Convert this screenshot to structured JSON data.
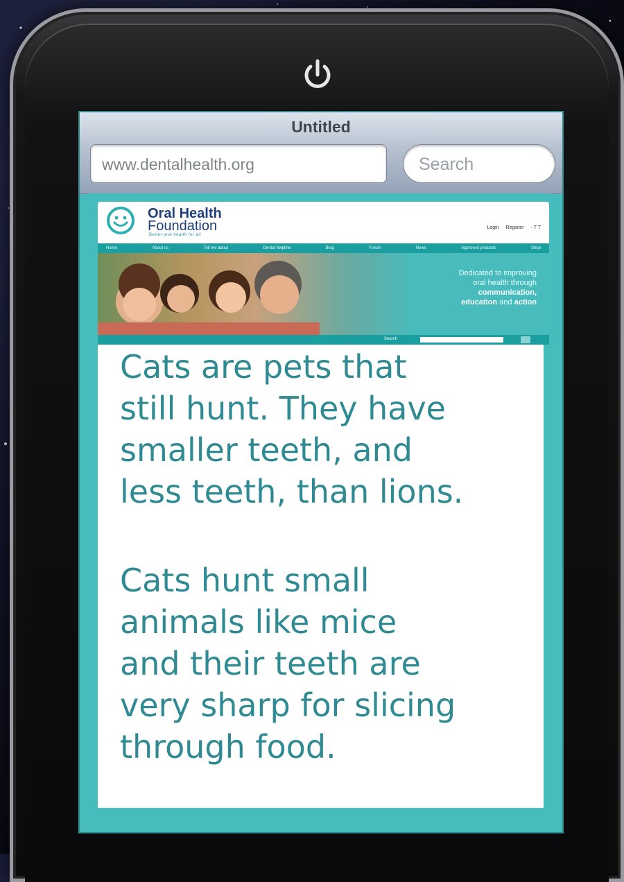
{
  "browser": {
    "title": "Untitled",
    "url": "www.dentalhealth.org",
    "search_placeholder": "Search"
  },
  "site": {
    "logo_line1": "Oral Health",
    "logo_line2": "Foundation",
    "tagline": "Better oral health for all",
    "header_links": [
      "Login",
      "Register",
      "- T T"
    ],
    "nav": [
      "Home",
      "About us",
      "Tell me about",
      "Dental helpline",
      "Blog",
      "Forum",
      "News",
      "Approved products",
      "Shop"
    ],
    "hero_caption_line1": "Dedicated to improving",
    "hero_caption_line2": "oral health through",
    "hero_caption_line3": "communication,",
    "hero_caption_line4a": "education",
    "hero_caption_line4b": "and",
    "hero_caption_line4c": "action",
    "hero_search_label": "Search"
  },
  "content": {
    "paragraph1_lines": [
      "Cats are pets that",
      "still hunt. They have",
      "smaller teeth, and",
      "less teeth, than lions."
    ],
    "paragraph2_lines": [
      "Cats hunt small",
      "animals like mice",
      "and their teeth are",
      "very sharp for slicing",
      "through food."
    ]
  },
  "colors": {
    "teal": "#46bcbc",
    "text": "#2f8a93",
    "logo_blue": "#1e3f7a"
  },
  "icons": {
    "power": "power-icon",
    "logo": "smiley-icon",
    "search": "search-icon"
  }
}
